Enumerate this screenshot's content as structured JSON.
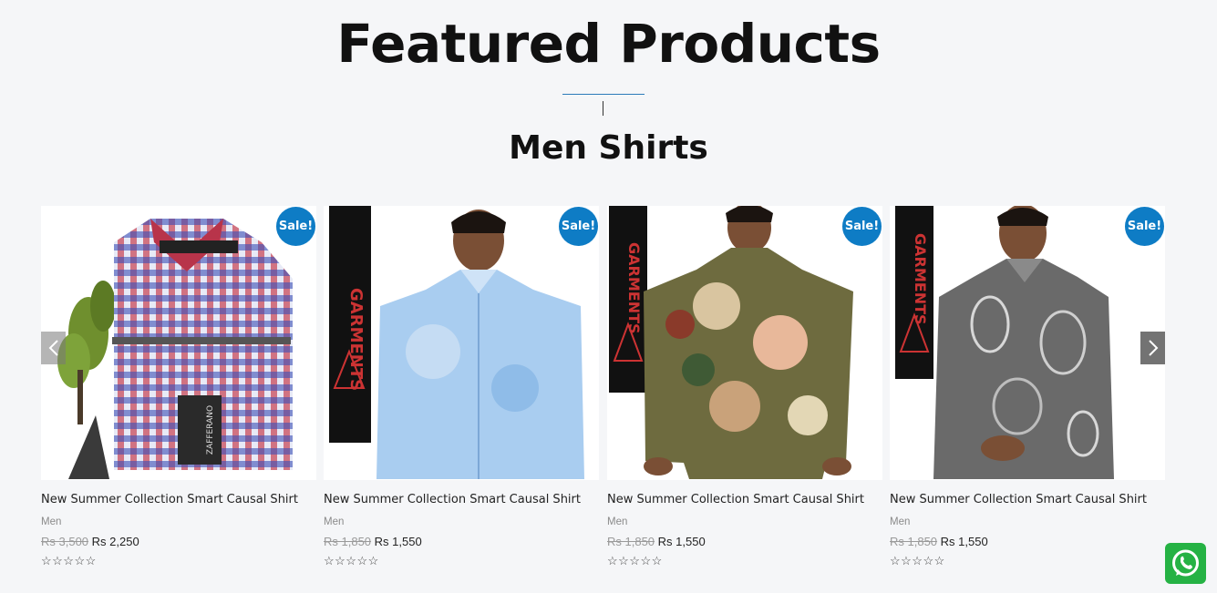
{
  "section": {
    "heading": "Featured Products",
    "subheading": "Men Shirts"
  },
  "colors": {
    "accent": "#0e7cc5",
    "background": "#f5f6f8",
    "whatsapp": "#25b244"
  },
  "products": [
    {
      "sale_label": "Sale!",
      "title": "New Summer Collection Smart Causal Shirt",
      "category": "Men",
      "old_price": "Rs 3,500",
      "new_price": "Rs 2,250",
      "rating": 0,
      "stars": "☆☆☆☆☆",
      "image": "checkered-shirt-image"
    },
    {
      "sale_label": "Sale!",
      "title": "New Summer Collection Smart Causal Shirt",
      "category": "Men",
      "old_price": "Rs 1,850",
      "new_price": "Rs 1,550",
      "rating": 0,
      "stars": "☆☆☆☆☆",
      "image": "light-blue-shirt-image"
    },
    {
      "sale_label": "Sale!",
      "title": "New Summer Collection Smart Causal Shirt",
      "category": "Men",
      "old_price": "Rs 1,850",
      "new_price": "Rs 1,550",
      "rating": 0,
      "stars": "☆☆☆☆☆",
      "image": "floral-shirt-image"
    },
    {
      "sale_label": "Sale!",
      "title": "New Summer Collection Smart Causal Shirt",
      "category": "Men",
      "old_price": "Rs 1,850",
      "new_price": "Rs 1,550",
      "rating": 0,
      "stars": "☆☆☆☆☆",
      "image": "paisley-shirt-image"
    }
  ],
  "carousel": {
    "prev_icon": "chevron-left-icon",
    "next_icon": "chevron-right-icon"
  },
  "whatsapp": {
    "icon": "whatsapp-icon"
  }
}
